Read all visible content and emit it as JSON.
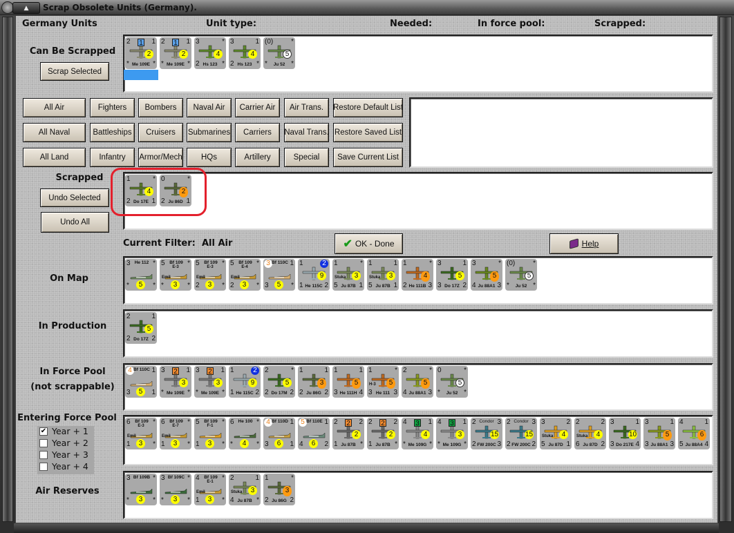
{
  "window": {
    "title": "Scrap Obsolete Units (Germany)."
  },
  "header": {
    "units": "Germany Units",
    "unit_type": "Unit type:",
    "needed": "Needed:",
    "in_force_pool": "In force pool:",
    "scrapped": "Scrapped:"
  },
  "labels": {
    "can_be_scrapped": "Can Be Scrapped",
    "scrapped": "Scrapped",
    "on_map": "On Map",
    "in_production": "In Production",
    "in_force_pool": "In Force Pool",
    "not_scrappable": "(not scrappable)",
    "entering_force_pool": "Entering Force Pool",
    "air_reserves": "Air Reserves",
    "current_filter_label": "Current Filter:",
    "current_filter_value": "All Air"
  },
  "buttons": {
    "scrap_selected": "Scrap Selected",
    "undo_selected": "Undo Selected",
    "undo_all": "Undo All",
    "ok_done": "OK - Done",
    "help": "Help"
  },
  "filters": [
    [
      "All Air",
      "Fighters",
      "Bombers",
      "Naval Air",
      "Carrier Air",
      "Air Trans.",
      "Restore Default List"
    ],
    [
      "All Naval",
      "Battleships",
      "Cruisers",
      "Submarines",
      "Carriers",
      "Naval Trans.",
      "Restore Saved List"
    ],
    [
      "All Land",
      "Infantry",
      "Armor/Mech",
      "HQs",
      "Artillery",
      "Special",
      "Save Current List"
    ]
  ],
  "years": [
    {
      "label": "Year + 1",
      "checked": true
    },
    {
      "label": "Year + 2",
      "checked": false
    },
    {
      "label": "Year + 3",
      "checked": false
    },
    {
      "label": "Year + 4",
      "checked": false
    }
  ],
  "colors": {
    "accent_red": "#e3202c",
    "selection": "#3d9af0"
  },
  "sections": {
    "can_be_scrapped": {
      "units": [
        {
          "tl": "2",
          "sq": "1",
          "sqc": "#5aa0e8",
          "tr": "1",
          "bl": "*",
          "br": "*",
          "name": "Me 109E",
          "val": "2",
          "vc": "yellow",
          "vp": "r",
          "camo": "#8a8a70",
          "selected": true
        },
        {
          "tl": "2",
          "sq": "1",
          "sqc": "#5aa0e8",
          "tr": "1",
          "bl": "*",
          "br": "*",
          "name": "Me 109E",
          "val": "2",
          "vc": "yellow",
          "vp": "r",
          "camo": "#8a8a70"
        },
        {
          "tl": "3",
          "tr": "*",
          "bl": "2",
          "br": "*",
          "name": "Hs 123",
          "val": "4",
          "vc": "yellow",
          "vp": "r",
          "camo": "#5e8a2a"
        },
        {
          "tl": "3",
          "tr": "1",
          "bl": "2",
          "br": "*",
          "name": "Hs 123",
          "val": "4",
          "vc": "yellow",
          "vp": "r",
          "camo": "#5e8a2a"
        },
        {
          "tl": "(0)",
          "tr": "*",
          "bl": "*",
          "br": "*",
          "name": "Ju 52",
          "val": "5",
          "vc": "white",
          "vp": "r",
          "camo": "#6a8a4a"
        }
      ]
    },
    "scrapped": {
      "units": [
        {
          "tl": "1",
          "tr": "*",
          "bl": "2",
          "br": "1",
          "name": "Do 17E",
          "val": "4",
          "vc": "yellow",
          "vp": "r",
          "camo": "#5a7a2a"
        },
        {
          "tl": "0",
          "tr": "*",
          "bl": "2",
          "br": "1",
          "name": "Ju 86D",
          "val": "2",
          "vc": "orange",
          "vp": "r",
          "camo": "#5a6a3a"
        }
      ]
    },
    "on_map": {
      "units": [
        {
          "tl": "3",
          "tr": "*",
          "bl": "*",
          "br": "*",
          "name": "He 112",
          "nt": true,
          "val": "5",
          "vc": "yellow",
          "vp": "bc",
          "camo": "#6a8a5a"
        },
        {
          "tl": "5",
          "tr": "*",
          "bl": "*",
          "br": "*",
          "name": "Bf 109",
          "sub": "E-3",
          "tag": "Emil",
          "nt": true,
          "val": "3",
          "vc": "yellow",
          "vp": "bc",
          "camo": "#c89a30"
        },
        {
          "tl": "5",
          "tr": "*",
          "bl": "2",
          "br": "*",
          "name": "Bf 109",
          "sub": "E-3",
          "tag": "Emil",
          "nt": true,
          "val": "3",
          "vc": "yellow",
          "vp": "bc",
          "camo": "#c89a30"
        },
        {
          "tl": "5",
          "tr": "*",
          "bl": "2",
          "br": "*",
          "name": "Bf 109",
          "sub": "E-4",
          "tag": "Emil",
          "nt": true,
          "val": "3",
          "vc": "yellow",
          "vp": "bc",
          "camo": "#c89a30"
        },
        {
          "tlc": "3",
          "tr": "1",
          "bl": "3",
          "br": "*",
          "name": "Bf 110C",
          "nt": true,
          "val": "5",
          "vc": "yellow",
          "vp": "bc",
          "camo": "#d8b070"
        },
        {
          "tl": "1",
          "trc": "2",
          "bl": "1",
          "br": "2",
          "name": "He 115C",
          "val": "9",
          "vc": "yellow",
          "vp": "r",
          "camo": "#9aaab0"
        },
        {
          "tl": "1",
          "tr": "*",
          "bl": "5",
          "br": "1",
          "name": "Ju 87B",
          "tag": "Stuka",
          "val": "3",
          "vc": "yellow",
          "vp": "r",
          "camo": "#7a8a5a"
        },
        {
          "tl": "1",
          "tr": "1",
          "bl": "5",
          "br": "1",
          "name": "Ju 87B",
          "tag": "Stuka",
          "val": "3",
          "vc": "yellow",
          "vp": "r",
          "camo": "#7a8a5a"
        },
        {
          "tl": "1",
          "tr": "*",
          "bl": "2",
          "br": "3",
          "name": "He 111B",
          "val": "4",
          "vc": "orange",
          "vp": "r",
          "camo": "#c06a20"
        },
        {
          "tl": "3",
          "tr": "1",
          "bl": "3",
          "br": "2",
          "name": "Do 17Z",
          "val": "5",
          "vc": "yellow",
          "vp": "r",
          "camo": "#3a6a20"
        },
        {
          "tl": "3",
          "tr": "*",
          "bl": "4",
          "br": "3",
          "name": "Ju 88A1",
          "val": "5",
          "vc": "orange",
          "vp": "r",
          "camo": "#6a8a20"
        },
        {
          "tl": "(0)",
          "tr": "*",
          "bl": "*",
          "br": "*",
          "name": "Ju 52",
          "val": "5",
          "vc": "white",
          "vp": "r",
          "camo": "#6a8a4a"
        }
      ]
    },
    "in_production": {
      "units": [
        {
          "tl": "2",
          "tr": "1",
          "bl": "2",
          "br": "2",
          "name": "Do 17Z",
          "val": "5",
          "vc": "yellow",
          "vp": "r",
          "camo": "#3a6a20"
        }
      ]
    },
    "in_force_pool": {
      "units": [
        {
          "tlc": "4",
          "tr": "1",
          "bl": "3",
          "br": "1",
          "name": "Bf 110C",
          "nt": true,
          "val": "5",
          "vc": "yellow",
          "vp": "bc",
          "camo": "#d8b070"
        },
        {
          "tl": "3",
          "sq": "2",
          "sqc": "#f08a30",
          "tr": "1",
          "bl": "*",
          "br": "*",
          "name": "Me 109E",
          "val": "3",
          "vc": "yellow",
          "vp": "r",
          "camo": "#7a7a7a"
        },
        {
          "tl": "3",
          "sq": "2",
          "sqc": "#f08a30",
          "tr": "1",
          "bl": "*",
          "br": "*",
          "name": "Me 109E",
          "val": "3",
          "vc": "yellow",
          "vp": "r",
          "camo": "#7a7a7a"
        },
        {
          "tl": "1",
          "trc": "2",
          "bl": "1",
          "br": "2",
          "name": "He 115C",
          "val": "9",
          "vc": "yellow",
          "vp": "r",
          "camo": "#9aaab0"
        },
        {
          "tl": "2",
          "tr": "*",
          "bl": "2",
          "br": "2",
          "name": "Do 17M",
          "val": "5",
          "vc": "yellow",
          "vp": "r",
          "camo": "#3a6a20"
        },
        {
          "tl": "1",
          "tr": "1",
          "bl": "2",
          "br": "2",
          "name": "Ju 86G",
          "val": "3",
          "vc": "orange",
          "vp": "r",
          "camo": "#5a6a3a"
        },
        {
          "tl": "1",
          "tr": "1",
          "bl": "3",
          "br": "4",
          "name": "He 111H",
          "val": "5",
          "vc": "orange",
          "vp": "r",
          "camo": "#c06a20"
        },
        {
          "tl": "1",
          "tr": "*",
          "bl": "3",
          "br": "3",
          "name": "He 111",
          "tag": "H-3",
          "val": "5",
          "vc": "orange",
          "vp": "r",
          "camo": "#c06a20"
        },
        {
          "tl": "2",
          "tr": "*",
          "bl": "4",
          "br": "3",
          "name": "Ju 88A1",
          "val": "5",
          "vc": "orange",
          "vp": "r",
          "camo": "#8a9a20"
        },
        {
          "tl": "0",
          "tr": "*",
          "bl": "*",
          "br": "*",
          "name": "Ju 52",
          "val": "5",
          "vc": "white",
          "vp": "r",
          "camo": "#6a8a4a"
        }
      ]
    },
    "entering_force_pool": {
      "units": [
        {
          "tl": "6",
          "tr": "*",
          "bl": "1",
          "br": "*",
          "name": "Bf 109",
          "sub": "E-3",
          "tag": "Emil",
          "nt": true,
          "val": "3",
          "vc": "yellow",
          "vp": "bc",
          "camo": "#c89a30"
        },
        {
          "tl": "6",
          "tr": "*",
          "bl": "1",
          "br": "*",
          "name": "Bf 109",
          "sub": "E-7",
          "tag": "Emil",
          "nt": true,
          "val": "3",
          "vc": "yellow",
          "vp": "bc",
          "camo": "#c89a30"
        },
        {
          "tl": "5",
          "tr": "*",
          "bl": "1",
          "br": "*",
          "name": "Bf 109",
          "sub": "F-1",
          "nt": true,
          "val": "3",
          "vc": "yellow",
          "vp": "bc",
          "camo": "#e0a020"
        },
        {
          "tl": "6",
          "tr": "*",
          "bl": "*",
          "br": "*",
          "name": "He 100",
          "nt": true,
          "val": "4",
          "vc": "yellow",
          "vp": "bc",
          "camo": "#4a6a3a"
        },
        {
          "tlc": "4",
          "tr": "1",
          "bl": "3",
          "br": "1",
          "name": "Bf 110D",
          "nt": true,
          "val": "6",
          "vc": "yellow",
          "vp": "bc",
          "camo": "#c8a040"
        },
        {
          "tlc": "5",
          "tr": "1",
          "bl": "4",
          "br": "2",
          "name": "Bf 110E",
          "nt": true,
          "val": "6",
          "vc": "yellow",
          "vp": "bc",
          "camo": "#6a8a7a"
        },
        {
          "tl": "2",
          "sq": "2",
          "sqc": "#f08a30",
          "tr": "2",
          "bl": "1",
          "br": "*",
          "name": "Ju 87B",
          "val": "2",
          "vc": "yellow",
          "vp": "r",
          "camo": "#6a6a6a"
        },
        {
          "tl": "2",
          "sq": "2",
          "sqc": "#f08a30",
          "tr": "2",
          "bl": "1",
          "br": "*",
          "name": "Ju 87B",
          "val": "2",
          "vc": "yellow",
          "vp": "r",
          "camo": "#6a6a6a"
        },
        {
          "tl": "4",
          "sq": "3",
          "sqc": "#10a040",
          "tr": "1",
          "bl": "*",
          "br": "*",
          "name": "Me 109G",
          "val": "4",
          "vc": "yellow",
          "vp": "r",
          "camo": "#8a8a8a"
        },
        {
          "tl": "4",
          "sq": "3",
          "sqc": "#10a040",
          "tr": "1",
          "bl": "*",
          "br": "*",
          "name": "Me 109G",
          "val": "3",
          "vc": "yellow",
          "vp": "r",
          "camo": "#8a8a8a"
        },
        {
          "tl": "2",
          "tr": "3",
          "bl": "2",
          "br": "3",
          "name": "FW 200C",
          "top": "Condor",
          "val": "15",
          "vc": "yellow",
          "vp": "r",
          "camo": "#3a7a8a"
        },
        {
          "tl": "2",
          "tr": "3",
          "bl": "2",
          "br": "2",
          "name": "FW 200C",
          "top": "Condor",
          "val": "15",
          "vc": "yellow",
          "vp": "r",
          "camo": "#3a7a8a"
        },
        {
          "tl": "3",
          "tr": "2",
          "bl": "5",
          "br": "1",
          "name": "Ju 87D",
          "tag": "Stuka",
          "val": "4",
          "vc": "yellow",
          "vp": "r",
          "camo": "#e0a020"
        },
        {
          "tl": "2",
          "tr": "2",
          "bl": "6",
          "br": "2",
          "name": "Ju 87D",
          "tag": "Stuka",
          "val": "4",
          "vc": "yellow",
          "vp": "r",
          "camo": "#e0a020"
        },
        {
          "tl": "3",
          "tr": "1",
          "bl": "3",
          "br": "4",
          "name": "Do 217E",
          "val": "10",
          "vc": "yellow",
          "vp": "r",
          "camo": "#3a6a20"
        },
        {
          "tl": "3",
          "tr": "1",
          "bl": "3",
          "br": "3",
          "name": "Ju 88A1",
          "val": "5",
          "vc": "orange",
          "vp": "r",
          "camo": "#8a9a20"
        },
        {
          "tl": "4",
          "tr": "1",
          "bl": "5",
          "br": "4",
          "name": "Ju 88A4",
          "val": "6",
          "vc": "orange",
          "vp": "r",
          "camo": "#8ac040"
        }
      ]
    },
    "air_reserves": {
      "units": [
        {
          "tl": "3",
          "tr": "*",
          "bl": "*",
          "br": "*",
          "name": "Bf 109B",
          "nt": true,
          "val": "3",
          "vc": "yellow",
          "vp": "bc",
          "camo": "#3a6a3a"
        },
        {
          "tl": "3",
          "tr": "*",
          "bl": "*",
          "br": "*",
          "name": "Bf 109C",
          "nt": true,
          "val": "3",
          "vc": "yellow",
          "vp": "bc",
          "camo": "#3a6a3a"
        },
        {
          "tl": "4",
          "tr": "*",
          "bl": "1",
          "br": "*",
          "name": "Bf 109",
          "sub": "E-1",
          "tag": "Emil",
          "nt": true,
          "val": "3",
          "vc": "yellow",
          "vp": "bc",
          "camo": "#c89a30"
        },
        {
          "tl": "2",
          "tr": "1",
          "bl": "4",
          "br": "*",
          "name": "Ju 87B",
          "tag": "Stuka",
          "val": "3",
          "vc": "yellow",
          "vp": "r",
          "camo": "#7a8a5a"
        },
        {
          "tl": "1",
          "tr": "*",
          "bl": "2",
          "br": "2",
          "name": "Ju 86G",
          "val": "3",
          "vc": "orange",
          "vp": "r",
          "camo": "#5a6a3a"
        }
      ]
    }
  }
}
